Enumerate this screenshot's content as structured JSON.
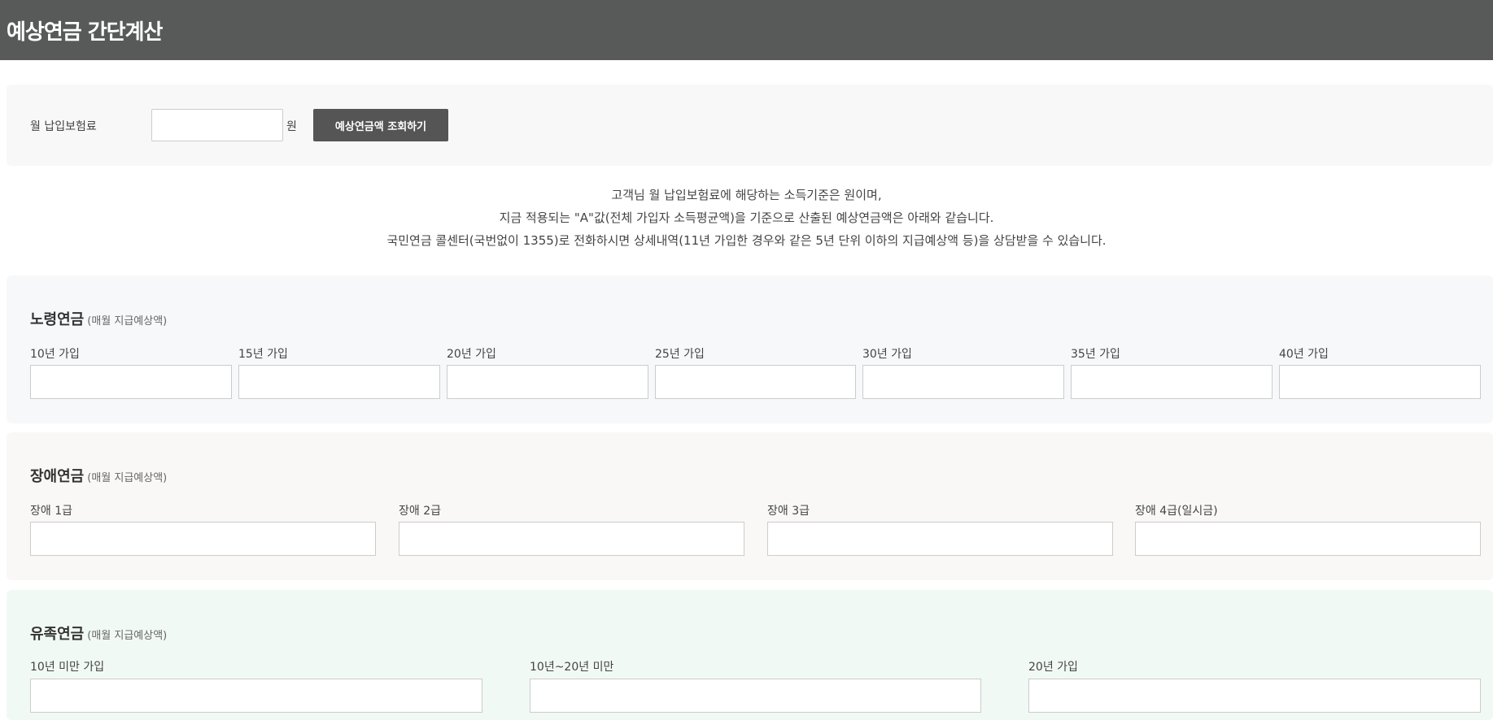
{
  "header": {
    "title": "예상연금 간단계산"
  },
  "search": {
    "label": "월 납입보험료",
    "input_value": "",
    "unit": "원",
    "button_label": "예상연금액 조회하기"
  },
  "info": {
    "lines": [
      "고객님 월 납입보험료에 해당하는 소득기준은 원이며,",
      "지금 적용되는 \"A\"값(전체 가입자 소득평균액)을 기준으로 산출된 예상연금액은 아래와 같습니다.",
      "국민연금 콜센터(국번없이 1355)로 전화하시면 상세내역(11년 가입한 경우와 같은 5년 단위 이하의 지급예상액 등)을 상담받을 수 있습니다."
    ]
  },
  "old_age": {
    "title": "노령연금",
    "subtitle": "(매월 지급예상액)",
    "fields": [
      {
        "label": "10년 가입",
        "value": ""
      },
      {
        "label": "15년 가입",
        "value": ""
      },
      {
        "label": "20년 가입",
        "value": ""
      },
      {
        "label": "25년 가입",
        "value": ""
      },
      {
        "label": "30년 가입",
        "value": ""
      },
      {
        "label": "35년 가입",
        "value": ""
      },
      {
        "label": "40년 가입",
        "value": ""
      }
    ]
  },
  "disability": {
    "title": "장애연금",
    "subtitle": "(매월 지급예상액)",
    "fields": [
      {
        "label": "장애 1급",
        "value": ""
      },
      {
        "label": "장애 2급",
        "value": ""
      },
      {
        "label": "장애 3급",
        "value": ""
      },
      {
        "label": "장애 4급(일시금)",
        "value": ""
      }
    ]
  },
  "survivor": {
    "title": "유족연금",
    "subtitle": "(매월 지급예상액)",
    "fields": [
      {
        "label": "10년 미만 가입",
        "value": ""
      },
      {
        "label": "10년~20년 미만",
        "value": ""
      },
      {
        "label": "20년 가입",
        "value": ""
      }
    ]
  },
  "colors": {
    "header_bg": "#585a59",
    "button_bg": "#555555",
    "old_age_bg": "#f7f8fa",
    "disability_bg": "#f9f8f6",
    "survivor_bg": "#f1f9f4"
  }
}
